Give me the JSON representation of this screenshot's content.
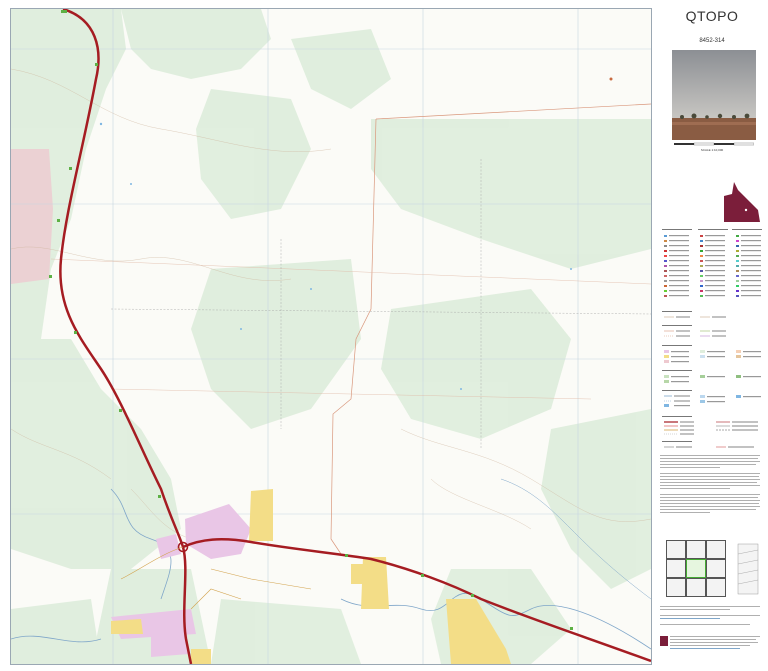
{
  "panel": {
    "title": "QTOPO",
    "map_id": "8452-314",
    "scale_text": "SCALE 1:10,000",
    "legend_sections": [
      "POINTS OF INTEREST",
      "RELIEF",
      "BOUNDARIES",
      "LAND USE",
      "LAND COVER",
      "HYDROGRAPHY",
      "TRANSPORTATION",
      "INFRASTRUCTURE"
    ],
    "state_color": "#7b1e3a"
  },
  "map": {
    "colors": {
      "vegetation": "#dfeedd",
      "road_main": "#a51c22",
      "road_marker": "#5db044",
      "urban_pink": "#e9c6e6",
      "urban_yellow": "#f3dd87",
      "contour": "#c9a98a",
      "grid": "#c7d5e1",
      "boundary": "#d89a7c",
      "river": "#7fa6c9"
    }
  }
}
